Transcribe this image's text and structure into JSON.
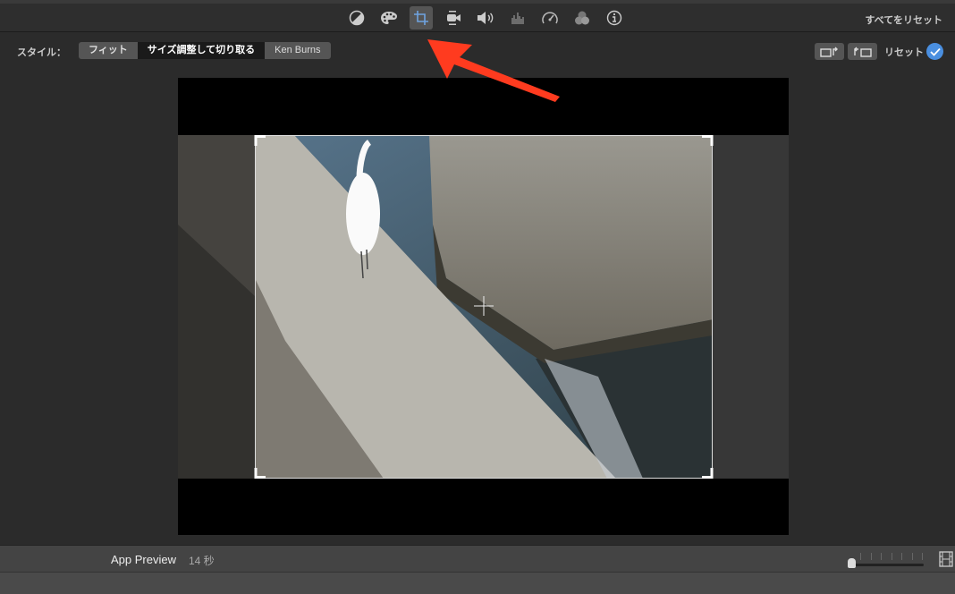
{
  "toolbar": {
    "tools": [
      {
        "name": "color-balance-icon",
        "active": false
      },
      {
        "name": "color-correction-icon",
        "active": false
      },
      {
        "name": "crop-icon",
        "active": true
      },
      {
        "name": "stabilization-icon",
        "active": false
      },
      {
        "name": "volume-icon",
        "active": false
      },
      {
        "name": "noise-reduction-equalizer-icon",
        "active": false
      },
      {
        "name": "speed-icon",
        "active": false
      },
      {
        "name": "clip-filter-icon",
        "active": false
      },
      {
        "name": "info-icon",
        "active": false
      }
    ],
    "reset_all": "すべてをリセット"
  },
  "style": {
    "label": "スタイル：",
    "options": [
      "フィット",
      "サイズ調整して切り取る",
      "Ken Burns"
    ],
    "selected": "サイズ調整して切り取る",
    "reset": "リセット"
  },
  "bottom": {
    "project_name": "App Preview",
    "duration": "14 秒",
    "zoom_value": 0
  },
  "colors": {
    "accent": "#4a8fe0",
    "annotation_arrow": "#ff3b1f"
  }
}
